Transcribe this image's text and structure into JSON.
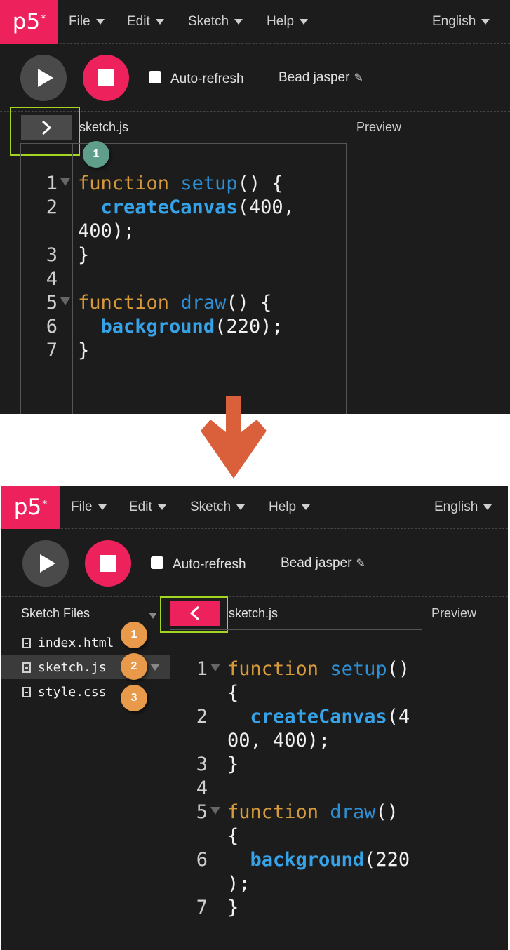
{
  "colors": {
    "accent": "#ed225d",
    "highlight": "#a3d61f",
    "arrow": "#d9603b",
    "badge_green": "#5f9e8a",
    "badge_orange": "#e8994a"
  },
  "nav": {
    "logo": "p5",
    "logo_mark": "*",
    "menu": [
      "File",
      "Edit",
      "Sketch",
      "Help"
    ],
    "language": "English"
  },
  "toolbar": {
    "auto_refresh_label": "Auto-refresh",
    "sketch_name": "Bead jasper",
    "edit_icon": "pencil-icon"
  },
  "editor": {
    "file_name": "sketch.js",
    "preview_label": "Preview",
    "line_numbers": [
      "1",
      "2",
      "3",
      "4",
      "5",
      "6",
      "7"
    ]
  },
  "top": {
    "toggle_icon": "chevron-right-icon",
    "badge": "1"
  },
  "bottom": {
    "toggle_icon": "chevron-left-icon",
    "sidebar_title": "Sketch Files",
    "files": [
      "index.html",
      "sketch.js",
      "style.css"
    ],
    "badges": [
      "1",
      "2",
      "3"
    ]
  },
  "code_tokens": {
    "function_kw": "function",
    "setup": "setup",
    "draw": "draw",
    "createCanvas": "createCanvas",
    "background": "background"
  }
}
